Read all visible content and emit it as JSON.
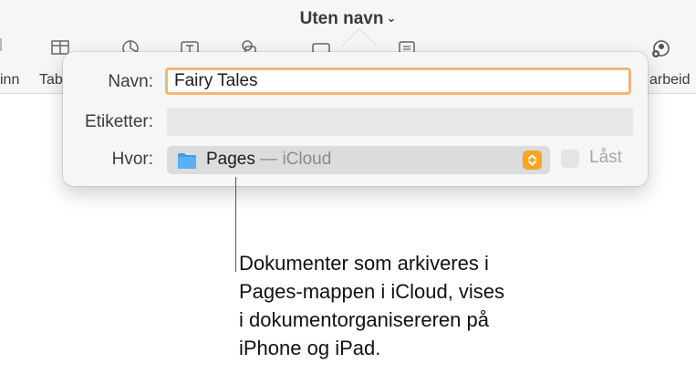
{
  "window": {
    "title": "Uten navn",
    "toolbar_left_labels": [
      "inn",
      "Tab"
    ],
    "toolbar_right_label": "arbeid"
  },
  "save_dialog": {
    "name_label": "Navn:",
    "name_value": "Fairy Tales",
    "tags_label": "Etiketter:",
    "tags_value": "",
    "where_label": "Hvor:",
    "where_value": "Pages",
    "where_separator": " — ",
    "where_location": "iCloud",
    "locked_label": "Låst",
    "locked_checked": false
  },
  "callout": {
    "lines": [
      "Dokumenter som arkiveres i",
      "Pages-mappen i iCloud, vises",
      "i dokumentorganisereren på",
      "iPhone og iPad."
    ]
  },
  "colors": {
    "focus_ring": "#f0b874",
    "stepper": "#f5a623",
    "folder": "#3d9be9"
  }
}
